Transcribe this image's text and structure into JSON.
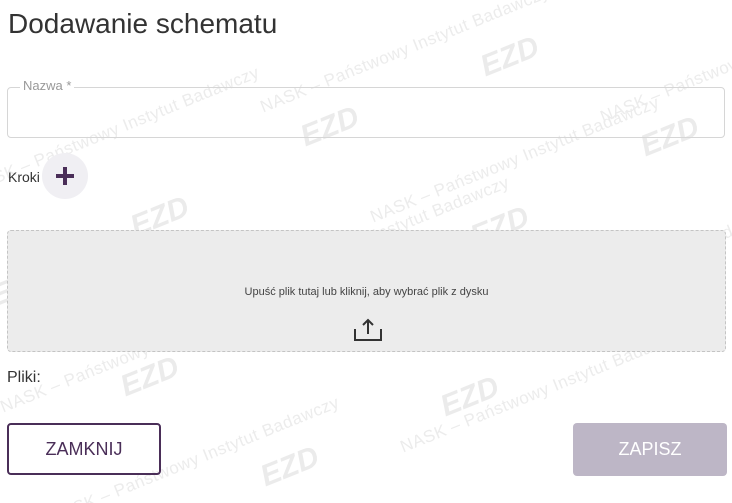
{
  "dialog": {
    "title": "Dodawanie schematu"
  },
  "form": {
    "name_label": "Nazwa *",
    "name_value": "",
    "steps_label": "Kroki"
  },
  "dropzone": {
    "text": "Upuść plik tutaj lub kliknij, aby wybrać plik z dysku"
  },
  "files": {
    "label": "Pliki:"
  },
  "actions": {
    "close_label": "ZAMKNIJ",
    "save_label": "ZAPISZ"
  },
  "watermark": {
    "org_text": "NASK – Państwowy Instytut Badawczy",
    "logo_text": "EZD RP"
  },
  "colors": {
    "accent": "#4a2e58",
    "save_disabled": "#bdb6c6",
    "dropzone_bg": "#ececec"
  },
  "icons": {
    "add_step": "plus-icon",
    "upload": "upload-icon"
  }
}
